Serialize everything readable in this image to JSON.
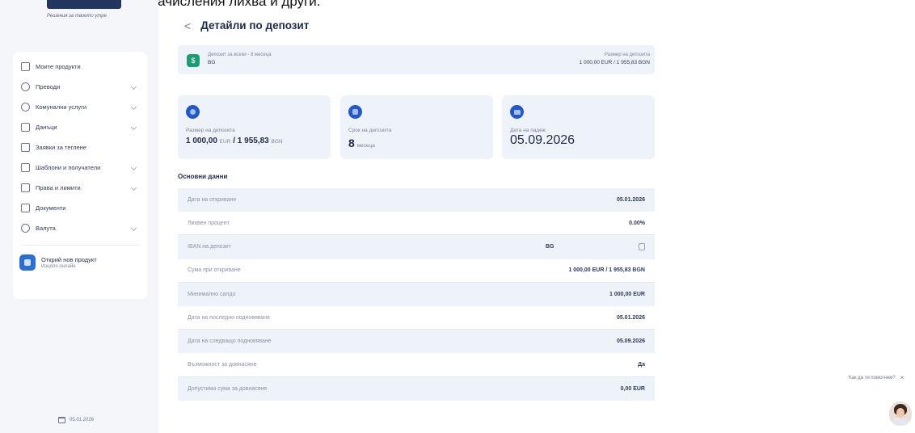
{
  "top_banner": "едновременно, текущо начисления лихва и други.",
  "sidebar": {
    "tagline": "Решения за твоето утре",
    "items": [
      {
        "label": "Моите продукти",
        "icon": "wallet-icon",
        "chevron": false
      },
      {
        "label": "Преводи",
        "icon": "transfer-icon",
        "chevron": true
      },
      {
        "label": "Комунални услуги",
        "icon": "bulb-icon",
        "chevron": true
      },
      {
        "label": "Данъци",
        "icon": "calculator-icon",
        "chevron": true
      },
      {
        "label": "Заявки за теглене",
        "icon": "bank-icon",
        "chevron": false
      },
      {
        "label": "Шаблони и получатели",
        "icon": "template-icon",
        "chevron": true
      },
      {
        "label": "Права и лимити",
        "icon": "rights-icon",
        "chevron": true
      },
      {
        "label": "Документи",
        "icon": "document-icon",
        "chevron": false
      },
      {
        "label": "Валута",
        "icon": "currency-icon",
        "chevron": true
      }
    ],
    "new_product": {
      "title": "Открий нов продукт",
      "subtitle": "Изцяло онлайн"
    },
    "date": "05.01.2026"
  },
  "header": {
    "back": "<",
    "title": "Детайли по депозит"
  },
  "deposit": {
    "name": "Депозит за всеки - 8 месеца",
    "sub": "BG",
    "amount_label": "Размер на депозита",
    "amount_value": "1 000,00 EUR / 1 955,83 BGN"
  },
  "cards": [
    {
      "label": "Размер на депозита",
      "value_main": "1 000,00",
      "value_cur1": "EUR",
      "value_mid": " / 1 955,83 ",
      "value_cur2": "BGN"
    },
    {
      "label": "Срок на депозита",
      "value_num": "8",
      "value_unit": "месеца"
    },
    {
      "label": "Дата на падеж",
      "value": "05.09.2026"
    }
  ],
  "section_title": "Основни данни",
  "details": [
    {
      "key": "Дата на откриване",
      "value": "05.01.2026"
    },
    {
      "key": "Лихвен процент",
      "value": "0.00%"
    },
    {
      "key": "IBAN на депозит",
      "value": "BG"
    },
    {
      "key": "Сума при откриване",
      "value": "1 000,00 EUR / 1 955,83 BGN"
    },
    {
      "key": "Минимално салдо",
      "value": "1 000,00 EUR"
    },
    {
      "key": "Дата на последно подновяване",
      "value": "05.01.2026"
    },
    {
      "key": "Дата на следващо подновяване",
      "value": "05.09.2026"
    },
    {
      "key": "Възможност за довнасяне",
      "value": "Да"
    },
    {
      "key": "Допустима сума за довнасяне",
      "value": "0,00 EUR"
    }
  ],
  "helper": {
    "text": "Как да ти помогнем?",
    "close": "×"
  },
  "colors": {
    "accent": "#2657c5",
    "panel": "#eef3fa",
    "sidebar_bg": "#f4f6fa",
    "deposit_icon": "#1f9b73"
  }
}
